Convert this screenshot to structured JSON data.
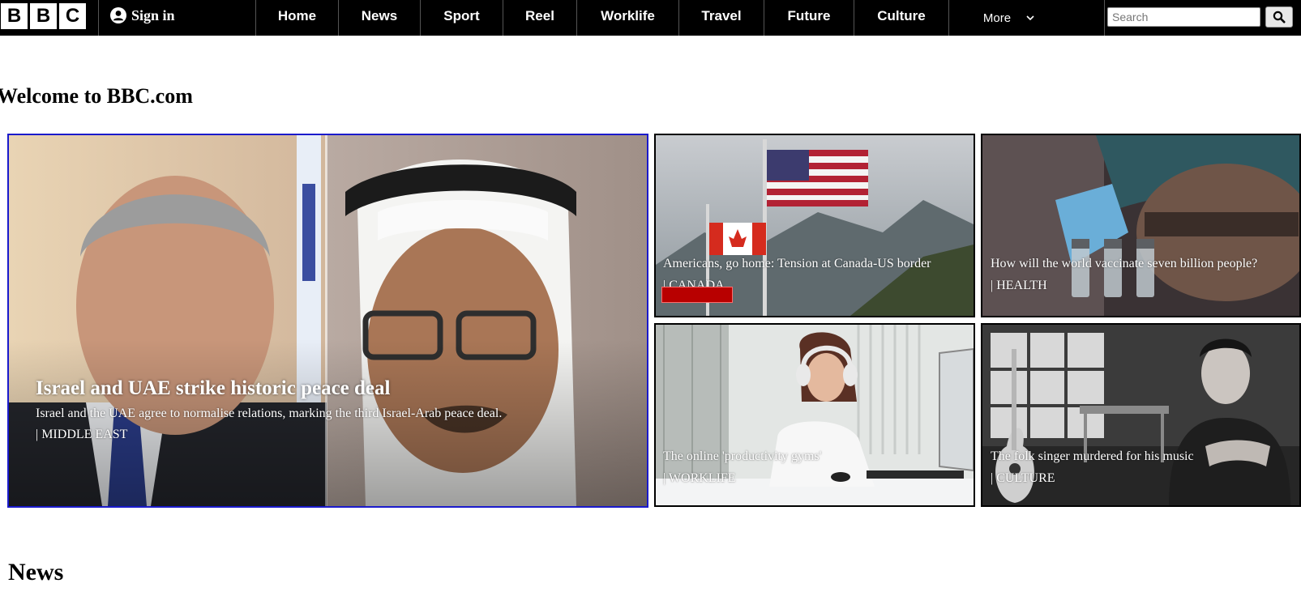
{
  "header": {
    "logo_letters": [
      "B",
      "B",
      "C"
    ],
    "signin_label": "Sign in",
    "nav": [
      "Home",
      "News",
      "Sport",
      "Reel",
      "Worklife",
      "Travel",
      "Future",
      "Culture"
    ],
    "more_label": "More",
    "search_placeholder": "Search"
  },
  "welcome_title": "Welcome to BBC.com",
  "hero": {
    "title": "Israel and UAE strike historic peace deal",
    "summary": "Israel and the UAE agree to normalise relations, marking the third Israel-Arab peace deal.",
    "tag": "| MIDDLE EAST"
  },
  "cards": [
    {
      "title": "Americans, go home: Tension at Canada-US border",
      "tag": "| CANADA"
    },
    {
      "title": "How will the world vaccinate seven billion people?",
      "tag": "| HEALTH"
    },
    {
      "title": "The online 'productivity gyms'",
      "tag": "| WORKLIFE"
    },
    {
      "title": "The folk singer murdered for his music",
      "tag": "| CULTURE"
    }
  ],
  "news_heading": "News",
  "colors": {
    "bar": "#000000",
    "hero_border": "#1a1acc",
    "badge": "#b80000"
  }
}
